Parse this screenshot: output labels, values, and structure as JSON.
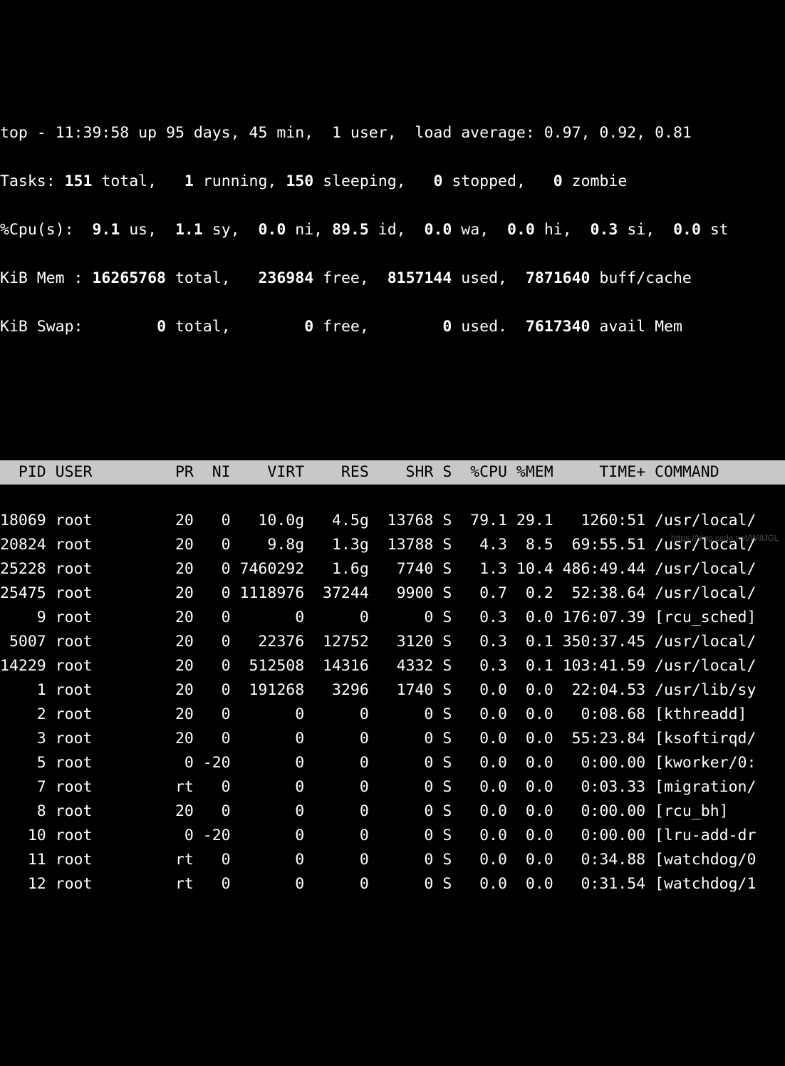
{
  "summary": {
    "line1": {
      "prefix": "top - ",
      "time": "11:39:58",
      "up_label": " up ",
      "uptime": "95 days, 45 min,  ",
      "users": "1 user,  ",
      "load_label": "load average: ",
      "load": "0.97, 0.92, 0.81"
    },
    "tasks": {
      "label": "Tasks: ",
      "total": "151",
      "total_lbl": " total,   ",
      "running": "1",
      "running_lbl": " running, ",
      "sleeping": "150",
      "sleeping_lbl": " sleeping,   ",
      "stopped": "0",
      "stopped_lbl": " stopped,   ",
      "zombie": "0",
      "zombie_lbl": " zombie"
    },
    "cpu": {
      "label": "%Cpu(s):  ",
      "us": "9.1",
      "us_lbl": " us,  ",
      "sy": "1.1",
      "sy_lbl": " sy,  ",
      "ni": "0.0",
      "ni_lbl": " ni, ",
      "id": "89.5",
      "id_lbl": " id,  ",
      "wa": "0.0",
      "wa_lbl": " wa,  ",
      "hi": "0.0",
      "hi_lbl": " hi,  ",
      "si": "0.3",
      "si_lbl": " si,  ",
      "st": "0.0",
      "st_lbl": " st"
    },
    "mem": {
      "label": "KiB Mem : ",
      "total": "16265768",
      "total_lbl": " total,   ",
      "free": "236984",
      "free_lbl": " free,  ",
      "used": "8157144",
      "used_lbl": " used,  ",
      "buff": "7871640",
      "buff_lbl": " buff/cache"
    },
    "swap": {
      "label": "KiB Swap:        ",
      "total": "0",
      "total_lbl": " total,        ",
      "free": "0",
      "free_lbl": " free,        ",
      "used": "0",
      "used_lbl": " used.  ",
      "avail": "7617340",
      "avail_lbl": " avail Mem"
    }
  },
  "columns": [
    "PID",
    "USER",
    "PR",
    "NI",
    "VIRT",
    "RES",
    "SHR",
    "S",
    "%CPU",
    "%MEM",
    "TIME+",
    "COMMAND"
  ],
  "widths": [
    5,
    9,
    6,
    4,
    8,
    7,
    7,
    2,
    5,
    5,
    10,
    12
  ],
  "processes": [
    {
      "pid": "18069",
      "user": "root",
      "pr": "20",
      "ni": "0",
      "virt": "10.0g",
      "res": "4.5g",
      "shr": "13768",
      "s": "S",
      "cpu": "79.1",
      "mem": "29.1",
      "time": "1260:51",
      "cmd": "/usr/local/"
    },
    {
      "pid": "20824",
      "user": "root",
      "pr": "20",
      "ni": "0",
      "virt": "9.8g",
      "res": "1.3g",
      "shr": "13788",
      "s": "S",
      "cpu": "4.3",
      "mem": "8.5",
      "time": "69:55.51",
      "cmd": "/usr/local/"
    },
    {
      "pid": "25228",
      "user": "root",
      "pr": "20",
      "ni": "0",
      "virt": "7460292",
      "res": "1.6g",
      "shr": "7740",
      "s": "S",
      "cpu": "1.3",
      "mem": "10.4",
      "time": "486:49.44",
      "cmd": "/usr/local/"
    },
    {
      "pid": "25475",
      "user": "root",
      "pr": "20",
      "ni": "0",
      "virt": "1118976",
      "res": "37244",
      "shr": "9900",
      "s": "S",
      "cpu": "0.7",
      "mem": "0.2",
      "time": "52:38.64",
      "cmd": "/usr/local/"
    },
    {
      "pid": "9",
      "user": "root",
      "pr": "20",
      "ni": "0",
      "virt": "0",
      "res": "0",
      "shr": "0",
      "s": "S",
      "cpu": "0.3",
      "mem": "0.0",
      "time": "176:07.39",
      "cmd": "[rcu_sched]"
    },
    {
      "pid": "5007",
      "user": "root",
      "pr": "20",
      "ni": "0",
      "virt": "22376",
      "res": "12752",
      "shr": "3120",
      "s": "S",
      "cpu": "0.3",
      "mem": "0.1",
      "time": "350:37.45",
      "cmd": "/usr/local/"
    },
    {
      "pid": "14229",
      "user": "root",
      "pr": "20",
      "ni": "0",
      "virt": "512508",
      "res": "14316",
      "shr": "4332",
      "s": "S",
      "cpu": "0.3",
      "mem": "0.1",
      "time": "103:41.59",
      "cmd": "/usr/local/"
    },
    {
      "pid": "1",
      "user": "root",
      "pr": "20",
      "ni": "0",
      "virt": "191268",
      "res": "3296",
      "shr": "1740",
      "s": "S",
      "cpu": "0.0",
      "mem": "0.0",
      "time": "22:04.53",
      "cmd": "/usr/lib/sy"
    },
    {
      "pid": "2",
      "user": "root",
      "pr": "20",
      "ni": "0",
      "virt": "0",
      "res": "0",
      "shr": "0",
      "s": "S",
      "cpu": "0.0",
      "mem": "0.0",
      "time": "0:08.68",
      "cmd": "[kthreadd] "
    },
    {
      "pid": "3",
      "user": "root",
      "pr": "20",
      "ni": "0",
      "virt": "0",
      "res": "0",
      "shr": "0",
      "s": "S",
      "cpu": "0.0",
      "mem": "0.0",
      "time": "55:23.84",
      "cmd": "[ksoftirqd/"
    },
    {
      "pid": "5",
      "user": "root",
      "pr": "0",
      "ni": "-20",
      "virt": "0",
      "res": "0",
      "shr": "0",
      "s": "S",
      "cpu": "0.0",
      "mem": "0.0",
      "time": "0:00.00",
      "cmd": "[kworker/0:"
    },
    {
      "pid": "7",
      "user": "root",
      "pr": "rt",
      "ni": "0",
      "virt": "0",
      "res": "0",
      "shr": "0",
      "s": "S",
      "cpu": "0.0",
      "mem": "0.0",
      "time": "0:03.33",
      "cmd": "[migration/"
    },
    {
      "pid": "8",
      "user": "root",
      "pr": "20",
      "ni": "0",
      "virt": "0",
      "res": "0",
      "shr": "0",
      "s": "S",
      "cpu": "0.0",
      "mem": "0.0",
      "time": "0:00.00",
      "cmd": "[rcu_bh]"
    },
    {
      "pid": "10",
      "user": "root",
      "pr": "0",
      "ni": "-20",
      "virt": "0",
      "res": "0",
      "shr": "0",
      "s": "S",
      "cpu": "0.0",
      "mem": "0.0",
      "time": "0:00.00",
      "cmd": "[lru-add-dr"
    },
    {
      "pid": "11",
      "user": "root",
      "pr": "rt",
      "ni": "0",
      "virt": "0",
      "res": "0",
      "shr": "0",
      "s": "S",
      "cpu": "0.0",
      "mem": "0.0",
      "time": "0:34.88",
      "cmd": "[watchdog/0"
    },
    {
      "pid": "12",
      "user": "root",
      "pr": "rt",
      "ni": "0",
      "virt": "0",
      "res": "0",
      "shr": "0",
      "s": "S",
      "cpu": "0.0",
      "mem": "0.0",
      "time": "0:31.54",
      "cmd": "[watchdog/1"
    }
  ],
  "watermark": "https://blog.csdn.net/WillJGL"
}
